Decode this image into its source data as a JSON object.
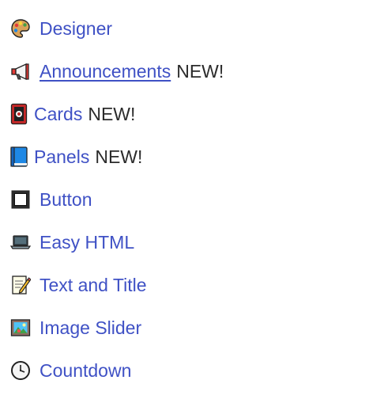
{
  "menu": {
    "items": [
      {
        "label": "Designer",
        "icon": "palette-icon",
        "badge": ""
      },
      {
        "label": "Announcements",
        "icon": "megaphone-icon",
        "badge": "NEW!"
      },
      {
        "label": "Cards",
        "icon": "playing-card-icon",
        "badge": "NEW!"
      },
      {
        "label": "Panels",
        "icon": "blue-book-icon",
        "badge": "NEW!"
      },
      {
        "label": "Button",
        "icon": "square-button-icon",
        "badge": ""
      },
      {
        "label": "Easy HTML",
        "icon": "laptop-icon",
        "badge": ""
      },
      {
        "label": "Text and Title",
        "icon": "memo-icon",
        "badge": ""
      },
      {
        "label": "Image Slider",
        "icon": "framed-picture-icon",
        "badge": ""
      },
      {
        "label": "Countdown",
        "icon": "clock-icon",
        "badge": ""
      }
    ]
  },
  "colors": {
    "link": "#3f51c5",
    "text": "#2b2b2b",
    "background": "#ffffff"
  }
}
